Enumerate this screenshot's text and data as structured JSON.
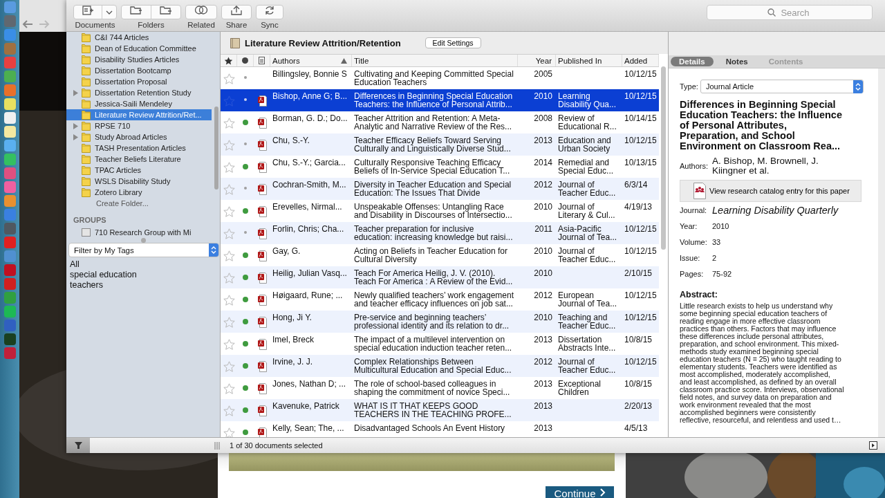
{
  "toolbar": {
    "buttons": [
      {
        "label": "Documents",
        "kind": "documents"
      },
      {
        "label": "Folders",
        "kind": "folders"
      },
      {
        "label": "Related",
        "kind": "related"
      },
      {
        "label": "Share",
        "kind": "share"
      },
      {
        "label": "Sync",
        "kind": "sync"
      }
    ],
    "search": {
      "placeholder": "Search"
    }
  },
  "sidebar": {
    "folders": [
      {
        "name": "C&I 744 Articles",
        "selected": false,
        "expandable": false
      },
      {
        "name": "Dean of Education Committee",
        "selected": false,
        "expandable": false
      },
      {
        "name": "Disability Studies Articles",
        "selected": false,
        "expandable": false
      },
      {
        "name": "Dissertation Bootcamp",
        "selected": false,
        "expandable": false
      },
      {
        "name": "Dissertation Proposal",
        "selected": false,
        "expandable": false
      },
      {
        "name": "Dissertation Retention Study",
        "selected": false,
        "expandable": true
      },
      {
        "name": "Jessica-Saili Mendeley",
        "selected": false,
        "expandable": false
      },
      {
        "name": "Literature Review Attrition/Ret...",
        "selected": true,
        "expandable": false
      },
      {
        "name": "RPSE 710",
        "selected": false,
        "expandable": true
      },
      {
        "name": "Study Abroad Articles",
        "selected": false,
        "expandable": true
      },
      {
        "name": "TASH Presentation Articles",
        "selected": false,
        "expandable": false
      },
      {
        "name": "Teacher Beliefs Literature",
        "selected": false,
        "expandable": false
      },
      {
        "name": "TPAC Articles",
        "selected": false,
        "expandable": false
      },
      {
        "name": "WSLS Disability Study",
        "selected": false,
        "expandable": false
      },
      {
        "name": "Zotero Library",
        "selected": false,
        "expandable": false
      }
    ],
    "create_folder": "Create Folder...",
    "groups_header": "GROUPS",
    "groups": [
      {
        "name": "710 Research Group with Mi"
      }
    ],
    "tag_filter": "Filter by My Tags",
    "tags": [
      "All",
      "special education",
      "teachers"
    ]
  },
  "library": {
    "title": "Literature Review Attrition/Retention",
    "edit_button": "Edit Settings",
    "columns": {
      "authors": "Authors",
      "title": "Title",
      "year": "Year",
      "published_in": "Published In",
      "added": "Added"
    },
    "rows": [
      {
        "authors": "Billingsley, Bonnie S",
        "title": "Cultivating and Keeping Committed Special\nEducation Teachers",
        "year": "2005",
        "added": "10/12/15",
        "starred": false,
        "unread": false,
        "has_pdf": false,
        "selected": false
      },
      {
        "authors": "Bishop, Anne G; B...",
        "title": "Differences in Beginning Special Education\nTeachers: the Influence of Personal Attrib...",
        "year": "2010",
        "published_in": "Learning\nDisability Qua...",
        "added": "10/12/15",
        "starred": false,
        "unread": false,
        "has_pdf": true,
        "selected": true
      },
      {
        "authors": "Borman, G. D.; Do...",
        "title": "Teacher Attrition and Retention: A Meta-\nAnalytic and Narrative Review of the Res...",
        "year": "2008",
        "published_in": "Review of\nEducational R...",
        "added": "10/14/15",
        "starred": false,
        "unread": true,
        "has_pdf": true,
        "selected": false
      },
      {
        "authors": "Chu, S.-Y.",
        "title": "Teacher Efficacy Beliefs Toward Serving\nCulturally and Linguistically Diverse Stud...",
        "year": "2013",
        "published_in": "Education and\nUrban Society",
        "added": "10/12/15",
        "starred": false,
        "unread": false,
        "has_pdf": true,
        "selected": false
      },
      {
        "authors": "Chu, S.-Y.; Garcia...",
        "title": "Culturally Responsive Teaching Efficacy\nBeliefs of In-Service Special Education T...",
        "year": "2014",
        "published_in": "Remedial and\nSpecial Educ...",
        "added": "10/13/15",
        "starred": false,
        "unread": true,
        "has_pdf": true,
        "selected": false
      },
      {
        "authors": "Cochran-Smith, M...",
        "title": "Diversity in Teacher Education and Special\nEducation: The Issues That Divide",
        "year": "2012",
        "published_in": "Journal of\nTeacher Educ...",
        "added": "6/3/14",
        "starred": false,
        "unread": false,
        "has_pdf": true,
        "selected": false
      },
      {
        "authors": "Erevelles, Nirmal...",
        "title": "Unspeakable Offenses: Untangling Race\nand Disability in Discourses of Intersectio...",
        "year": "2010",
        "published_in": "Journal of\nLiterary & Cul...",
        "added": "4/19/13",
        "starred": false,
        "unread": true,
        "has_pdf": true,
        "selected": false
      },
      {
        "authors": "Forlin, Chris; Cha...",
        "title": "Teacher preparation for inclusive\neducation: increasing knowledge but raisi...",
        "year": "2011",
        "published_in": "Asia-Pacific\nJournal of Tea...",
        "added": "10/12/15",
        "starred": false,
        "unread": false,
        "has_pdf": true,
        "selected": false
      },
      {
        "authors": "Gay, G.",
        "title": "Acting on Beliefs in Teacher Education for\nCultural Diversity",
        "year": "2010",
        "published_in": "Journal of\nTeacher Educ...",
        "added": "10/12/15",
        "starred": false,
        "unread": true,
        "has_pdf": true,
        "selected": false
      },
      {
        "authors": "Heilig, Julian Vasq...",
        "title": "Teach For America Heilig, J. V. (2010).\nTeach For America : A Review of the Evid...",
        "year": "2010",
        "added": "2/10/15",
        "starred": false,
        "unread": true,
        "has_pdf": true,
        "selected": false
      },
      {
        "authors": "Høigaard, Rune; ...",
        "title": "Newly qualified teachers’ work engagement\nand teacher efficacy influences on job sat...",
        "year": "2012",
        "published_in": "European\nJournal of Tea...",
        "added": "10/12/15",
        "starred": false,
        "unread": true,
        "has_pdf": true,
        "selected": false
      },
      {
        "authors": "Hong, Ji Y.",
        "title": "Pre-service and beginning teachers’\nprofessional identity and its relation to dr...",
        "year": "2010",
        "published_in": "Teaching and\nTeacher Educ...",
        "added": "10/12/15",
        "starred": false,
        "unread": true,
        "has_pdf": true,
        "selected": false
      },
      {
        "authors": "Imel, Breck",
        "title": "The impact of a multilevel intervention on\nspecial education induction teacher reten...",
        "year": "2013",
        "published_in": "Dissertation\nAbstracts Inte...",
        "added": "10/8/15",
        "starred": false,
        "unread": true,
        "has_pdf": true,
        "selected": false
      },
      {
        "authors": "Irvine, J. J.",
        "title": "Complex Relationships Between\nMulticultural Education and Special Educ...",
        "year": "2012",
        "published_in": "Journal of\nTeacher Educ...",
        "added": "10/12/15",
        "starred": false,
        "unread": true,
        "has_pdf": true,
        "selected": false
      },
      {
        "authors": "Jones, Nathan D; ...",
        "title": "The role of school-based colleagues in\nshaping the commitment of novice Speci...",
        "year": "2013",
        "published_in": "Exceptional\nChildren",
        "added": "10/8/15",
        "starred": false,
        "unread": true,
        "has_pdf": true,
        "selected": false
      },
      {
        "authors": "Kavenuke, Patrick",
        "title": "WHAT IS IT THAT KEEPS GOOD\nTEACHERS IN THE TEACHING PROFE...",
        "year": "2013",
        "added": "2/20/13",
        "starred": false,
        "unread": true,
        "has_pdf": true,
        "selected": false
      },
      {
        "authors": "Kelly, Sean; The, ...",
        "title": "Disadvantaged Schools An Event History",
        "year": "2013",
        "added": "4/5/13",
        "starred": false,
        "unread": true,
        "has_pdf": true,
        "selected": false
      }
    ]
  },
  "status_bar": "1 of 30 documents selected",
  "details": {
    "tabs": [
      {
        "label": "Details",
        "selected": true,
        "disabled": false
      },
      {
        "label": "Notes",
        "selected": false,
        "disabled": false
      },
      {
        "label": "Contents",
        "selected": false,
        "disabled": true
      }
    ],
    "type_label": "Type:",
    "type_value": "Journal Article",
    "title": "Differences in Beginning Special\nEducation Teachers: the Influence\nof Personal Attributes,\nPreparation, and School\nEnvironment on Classroom Rea...",
    "authors_label": "Authors:",
    "authors": "A. Bishop, M. Brownell, J.\nKiingner et al.",
    "catalog_button": "View research catalog entry for this paper",
    "fields": [
      {
        "label": "Journal:",
        "value": "Learning Disability Quarterly",
        "kind": "journal"
      },
      {
        "label": "Year:",
        "value": "2010",
        "kind": "plain"
      },
      {
        "label": "Volume:",
        "value": "33",
        "kind": "plain"
      },
      {
        "label": "Issue:",
        "value": "2",
        "kind": "plain"
      },
      {
        "label": "Pages:",
        "value": "75-92",
        "kind": "plain"
      }
    ],
    "abstract_heading": "Abstract:",
    "abstract": "Little research exists to help us understand why\nsome beginning special education teachers of\nreading engage in more effective classroom\npractices than others. Factors that may influence\nthese differences include personal attributes,\npreparation, and school environment. This mixed-\nmethods study examined beginning special\neducation teachers (N = 25) who taught reading to\nelementary students. Teachers were identified as\nmost accomplished, moderately accomplished,\nand least accomplished, as defined by an overall\nclassroom practice score. Interviews, observational\nfield notes, and survey data on preparation and\nwork environment revealed that the most\naccomplished beginners were consistently\nreflective, resourceful, and relentless and used t…"
  },
  "browser_page": {
    "continue_button": "Continue"
  }
}
